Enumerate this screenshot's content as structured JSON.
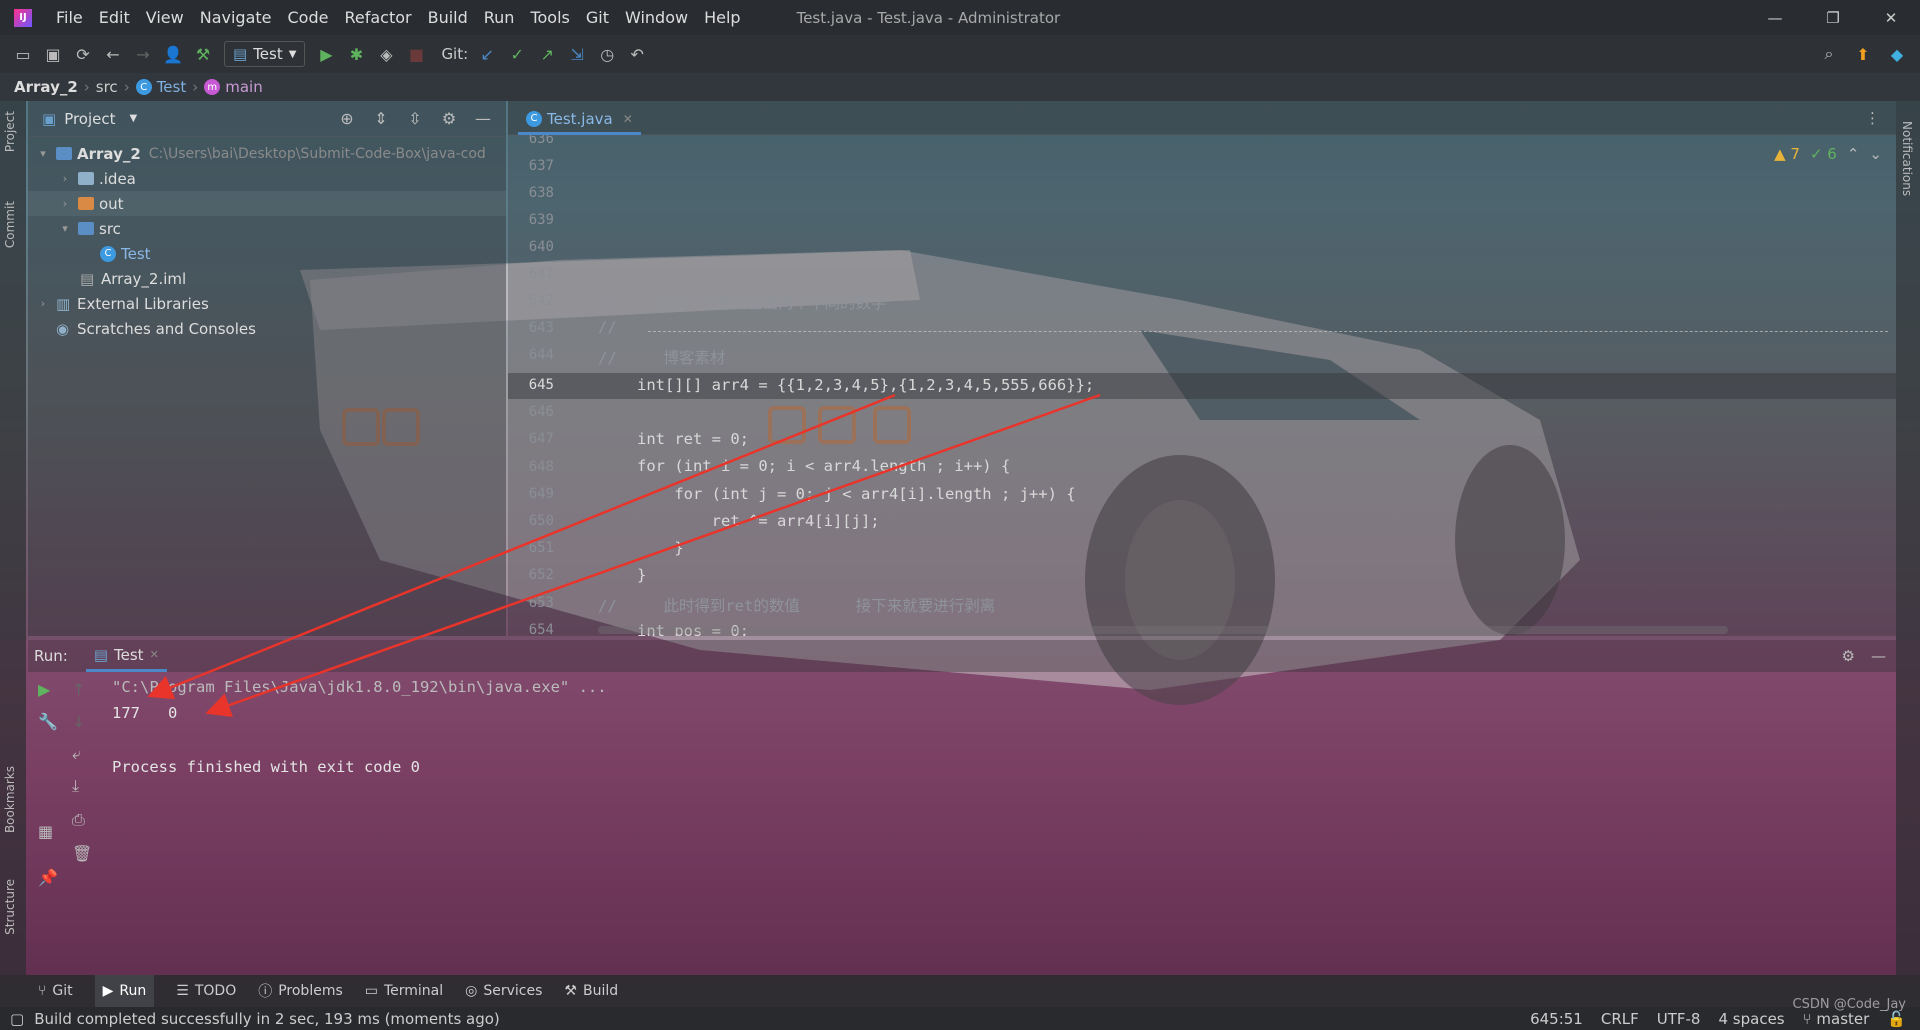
{
  "window": {
    "app_logo": "IJ",
    "title": "Test.java - Test.java - Administrator",
    "menu": [
      "File",
      "Edit",
      "View",
      "Navigate",
      "Code",
      "Refactor",
      "Build",
      "Run",
      "Tools",
      "Git",
      "Window",
      "Help"
    ]
  },
  "toolbar": {
    "run_config": "Test",
    "git_label": "Git:"
  },
  "breadcrumbs": {
    "project": "Array_2",
    "folder": "src",
    "class": "Test",
    "method": "main"
  },
  "left_stripe": {
    "project": "Project",
    "commit": "Commit",
    "bookmarks": "Bookmarks",
    "structure": "Structure"
  },
  "right_stripe": {
    "notifications": "Notifications"
  },
  "project_panel": {
    "title": "Project",
    "tree": [
      {
        "label": "Array_2",
        "hint": "C:\\Users\\bai\\Desktop\\Submit-Code-Box\\java-cod"
      },
      {
        "label": ".idea"
      },
      {
        "label": "out"
      },
      {
        "label": "src"
      },
      {
        "label": "Test"
      },
      {
        "label": "Array_2.iml"
      },
      {
        "label": "External Libraries"
      },
      {
        "label": "Scratches and Consoles"
      }
    ]
  },
  "editor": {
    "tab": "Test.java",
    "warnings": "▲ 7",
    "oks": "✓ 6",
    "line_numbers": [
      "636",
      "637",
      "638",
      "639",
      "640",
      "641",
      "642",
      "643",
      "644",
      "645",
      "646",
      "647",
      "648",
      "649",
      "650",
      "651",
      "652",
      "653",
      "654"
    ],
    "code": {
      "l642_comment": "//    找出一个数组里面两个不同的数字",
      "l643_comment": "//",
      "l644_comment": "//     博客素材",
      "l645": "int[][] arr4 = {{1,2,3,4,5},{1,2,3,4,5,555,666}};",
      "l647": "int ret = 0;",
      "l648": "for (int i = 0; i < arr4.length ; i++) {",
      "l649": "    for (int j = 0; j < arr4[i].length ; j++) {",
      "l650": "        ret ^= arr4[i][j];",
      "l651": "    }",
      "l652": "}",
      "l653_comment": "//     此时得到ret的数值      接下来就要进行剥离",
      "l654": "int pos = 0;"
    }
  },
  "run_panel": {
    "label": "Run:",
    "tab": "Test",
    "console": [
      "\"C:\\Program Files\\Java\\jdk1.8.0_192\\bin\\java.exe\" ...",
      "177   0",
      "",
      "Process finished with exit code 0"
    ]
  },
  "bottom_tabs": [
    "Git",
    "Run",
    "TODO",
    "Problems",
    "Terminal",
    "Services",
    "Build"
  ],
  "status": {
    "message": "Build completed successfully in 2 sec, 193 ms (moments ago)",
    "position": "645:51",
    "line_sep": "CRLF",
    "encoding": "UTF-8",
    "indent": "4 spaces",
    "branch": "master",
    "watermark": "CSDN @Code_Jay"
  },
  "colors": {
    "accent": "#4a88c7",
    "keyword": "#d98a3a",
    "number": "#3d86c6",
    "comment": "#8f939a",
    "warning": "#e8b33a",
    "arrow": "#e8342a"
  },
  "icons": [
    "open-folder-icon",
    "save-icon",
    "sync-icon",
    "back-icon",
    "forward-icon",
    "user-icon",
    "build-hammer-icon",
    "run-icon",
    "debug-icon",
    "coverage-icon",
    "stop-icon",
    "git-update-icon",
    "git-commit-icon",
    "git-push-icon",
    "git-pull-icon",
    "history-icon",
    "rollback-icon",
    "search-icon",
    "update-icon",
    "toolbox-icon"
  ]
}
